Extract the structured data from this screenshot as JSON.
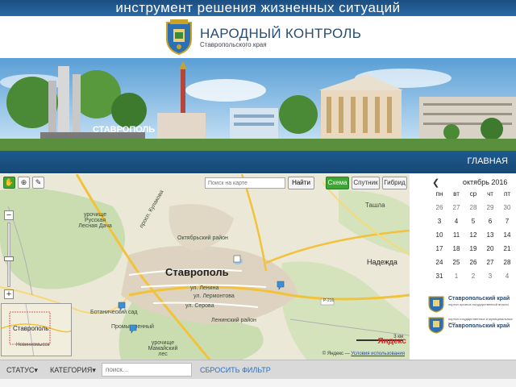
{
  "header": {
    "tagline": "инструмент решения жизненных ситуаций",
    "title": "НАРОДНЫЙ КОНТРОЛЬ",
    "subtitle": "Ставропольского края",
    "banner_sign": "СТАВРОПОЛЬ"
  },
  "nav": {
    "home": "ГЛАВНАЯ"
  },
  "map": {
    "search_placeholder": "Поиск на карте",
    "find_button": "Найти",
    "types": [
      "Схема",
      "Спутник",
      "Гибрид"
    ],
    "active_type": "Схема",
    "city": "Ставрополь",
    "labels": {
      "tashla": "Ташла",
      "nadezhda": "Надежда",
      "oktyabrsky": "Октябрьский район",
      "leninsky": "Ленинский район",
      "promyshlenny": "Промышленный",
      "botanichesky": "Ботанический сад",
      "urochishe": "урочище Русская Лесная Дача",
      "lenina": "ул. Ленина",
      "lermontova": "ул. Лермонтова",
      "serova": "ул. Серова",
      "kulakova": "просп. Кулакова",
      "r216": "Р-216",
      "mamaysky": "урочище Мамайский лес"
    },
    "minimap_city": "Ставрополь",
    "minimap_small": "Невинномысск",
    "scale": "3 км",
    "brand": "Яндекс",
    "copyright_prefix": "© Яндекс",
    "copyright_link": "Условия использования"
  },
  "calendar": {
    "prev": "❮",
    "month": "октябрь 2016",
    "weekdays": [
      "пн",
      "вт",
      "ср",
      "чт",
      "пт"
    ],
    "weeks": [
      [
        "26",
        "27",
        "28",
        "29",
        "30"
      ],
      [
        "3",
        "4",
        "5",
        "6",
        "7"
      ],
      [
        "10",
        "11",
        "12",
        "13",
        "14"
      ],
      [
        "17",
        "18",
        "19",
        "20",
        "21"
      ],
      [
        "24",
        "25",
        "26",
        "27",
        "28"
      ],
      [
        "31",
        "1",
        "2",
        "3",
        "4"
      ]
    ],
    "other_month": [
      [
        0,
        0
      ],
      [
        0,
        1
      ],
      [
        0,
        2
      ],
      [
        0,
        3
      ],
      [
        0,
        4
      ],
      [
        5,
        1
      ],
      [
        5,
        2
      ],
      [
        5,
        3
      ],
      [
        5,
        4
      ]
    ]
  },
  "gov_links": [
    {
      "name": "Ставропольский край",
      "sub": "портал органов государственной власти"
    },
    {
      "name": "Ставропольский край",
      "sub": "портал государственных и муниципальных услуг"
    }
  ],
  "filter": {
    "status": "СТАТУС",
    "category": "КАТЕГОРИЯ",
    "search_placeholder": "поиск...",
    "reset": "СБРОСИТЬ ФИЛЬТР"
  }
}
